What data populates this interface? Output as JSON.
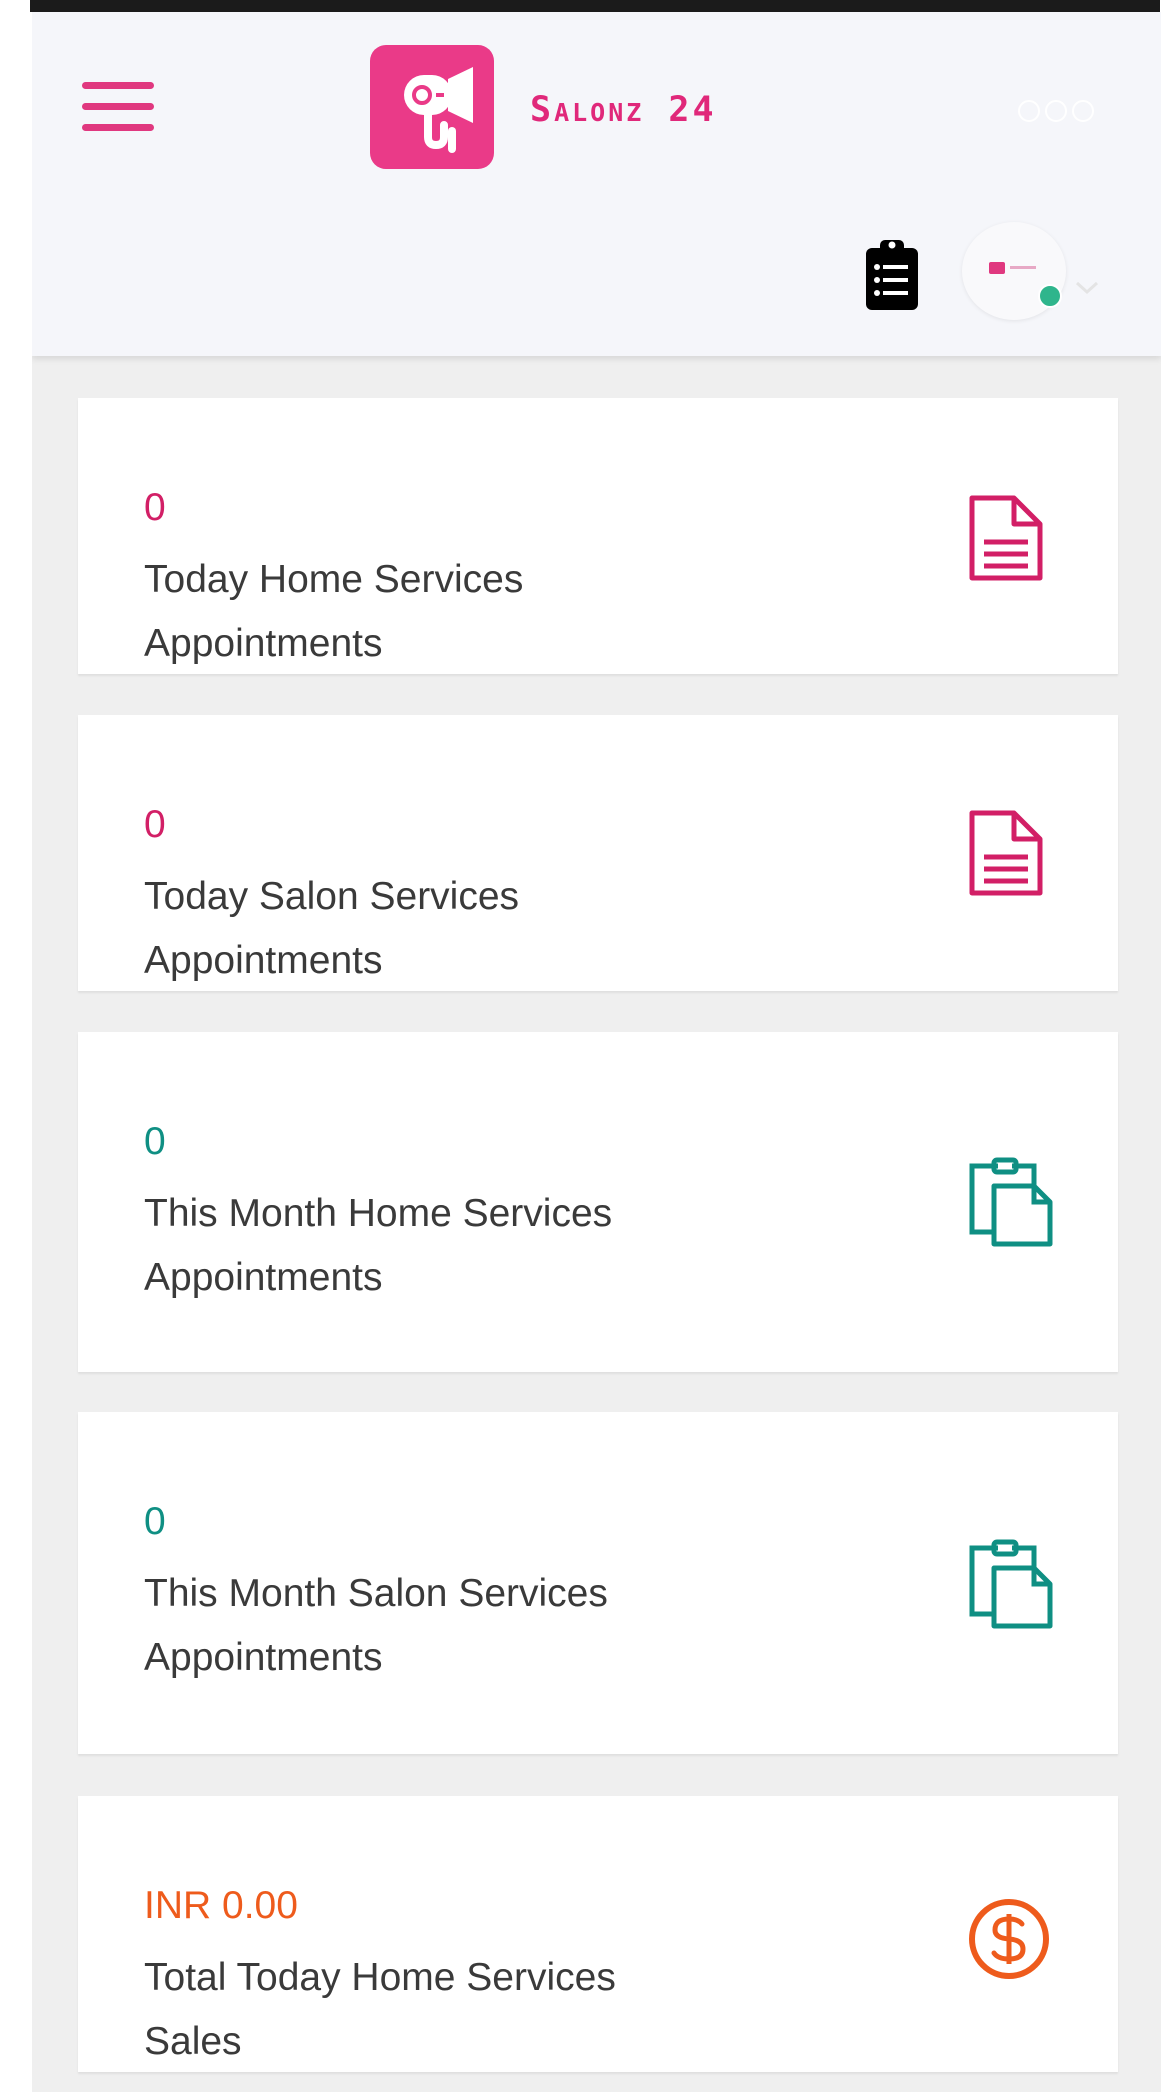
{
  "app": {
    "brand_name": "Salonz 24",
    "accent_color": "#e0387f",
    "header_background": "#f5f6fa",
    "icons": {
      "menu": "hamburger-menu-icon",
      "logo": "hair-dryer-logo-icon",
      "more": "more-options-icon",
      "clipboard": "clipboard-list-icon",
      "profile": "profile-avatar",
      "dropdown": "chevron-down-icon"
    }
  },
  "cards": [
    {
      "value": "0",
      "label": "Today Home Services Appointments",
      "value_color": "#d21f66",
      "icon": "document-icon"
    },
    {
      "value": "0",
      "label": "Today Salon Services Appointments",
      "value_color": "#d21f66",
      "icon": "document-icon"
    },
    {
      "value": "0",
      "label": "This Month Home Services Appointments",
      "value_color": "#0f8f83",
      "icon": "clipboard-copy-icon"
    },
    {
      "value": "0",
      "label": "This Month Salon Services Appointments",
      "value_color": "#0f8f83",
      "icon": "clipboard-copy-icon"
    },
    {
      "value": "INR 0.00",
      "label": "Total Today Home Services Sales",
      "value_color": "#ee5b1c",
      "icon": "dollar-coin-icon"
    }
  ]
}
